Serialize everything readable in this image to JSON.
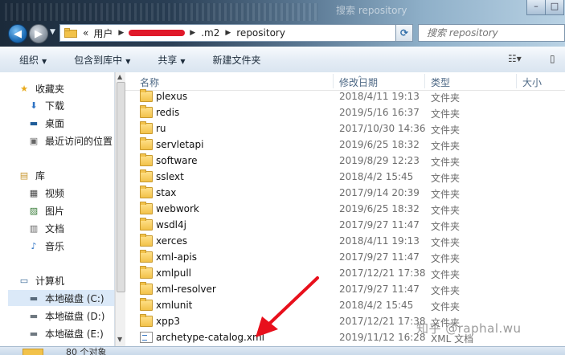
{
  "window": {
    "title_blurred": "",
    "search_ghost": "搜索 repository"
  },
  "address": {
    "crumbs": [
      "用户",
      ".m2",
      "repository"
    ],
    "overflow": "«"
  },
  "search": {
    "placeholder": "搜索 repository"
  },
  "toolbar": {
    "organize": "组织",
    "include_in_library": "包含到库中",
    "share": "共享",
    "new_folder": "新建文件夹"
  },
  "nav": {
    "favorites": "收藏夹",
    "downloads": "下载",
    "desktop": "桌面",
    "recent": "最近访问的位置",
    "libraries": "库",
    "videos": "视频",
    "pictures": "图片",
    "documents": "文档",
    "music": "音乐",
    "computer": "计算机",
    "drive_c": "本地磁盘 (C:)",
    "drive_d": "本地磁盘 (D:)",
    "drive_e": "本地磁盘 (E:)"
  },
  "columns": {
    "name": "名称",
    "modified": "修改日期",
    "type": "类型",
    "size": "大小"
  },
  "files": [
    {
      "name": "plexus",
      "date": "2018/4/11 19:13",
      "type": "文件夹",
      "kind": "folder"
    },
    {
      "name": "redis",
      "date": "2019/5/16 16:37",
      "type": "文件夹",
      "kind": "folder"
    },
    {
      "name": "ru",
      "date": "2017/10/30 14:36",
      "type": "文件夹",
      "kind": "folder"
    },
    {
      "name": "servletapi",
      "date": "2019/6/25 18:32",
      "type": "文件夹",
      "kind": "folder"
    },
    {
      "name": "software",
      "date": "2019/8/29 12:23",
      "type": "文件夹",
      "kind": "folder"
    },
    {
      "name": "sslext",
      "date": "2018/4/2 15:45",
      "type": "文件夹",
      "kind": "folder"
    },
    {
      "name": "stax",
      "date": "2017/9/14 20:39",
      "type": "文件夹",
      "kind": "folder"
    },
    {
      "name": "webwork",
      "date": "2019/6/25 18:32",
      "type": "文件夹",
      "kind": "folder"
    },
    {
      "name": "wsdl4j",
      "date": "2017/9/27 11:47",
      "type": "文件夹",
      "kind": "folder"
    },
    {
      "name": "xerces",
      "date": "2018/4/11 19:13",
      "type": "文件夹",
      "kind": "folder"
    },
    {
      "name": "xml-apis",
      "date": "2017/9/27 11:47",
      "type": "文件夹",
      "kind": "folder"
    },
    {
      "name": "xmlpull",
      "date": "2017/12/21 17:38",
      "type": "文件夹",
      "kind": "folder"
    },
    {
      "name": "xml-resolver",
      "date": "2017/9/27 11:47",
      "type": "文件夹",
      "kind": "folder"
    },
    {
      "name": "xmlunit",
      "date": "2018/4/2 15:45",
      "type": "文件夹",
      "kind": "folder"
    },
    {
      "name": "xpp3",
      "date": "2017/12/21 17:38",
      "type": "文件夹",
      "kind": "folder"
    },
    {
      "name": "archetype-catalog.xml",
      "date": "2019/11/12 16:28",
      "type": "XML 文档",
      "kind": "xml"
    }
  ],
  "status": {
    "count": "80 个对象"
  },
  "overlay": {
    "watermark": "知乎 @raphal.wu",
    "arrow_color": "#e8101c"
  },
  "colors": {
    "accent": "#1f6fb8",
    "folder": "#f2c24a",
    "selection": "#dbe9f8"
  }
}
